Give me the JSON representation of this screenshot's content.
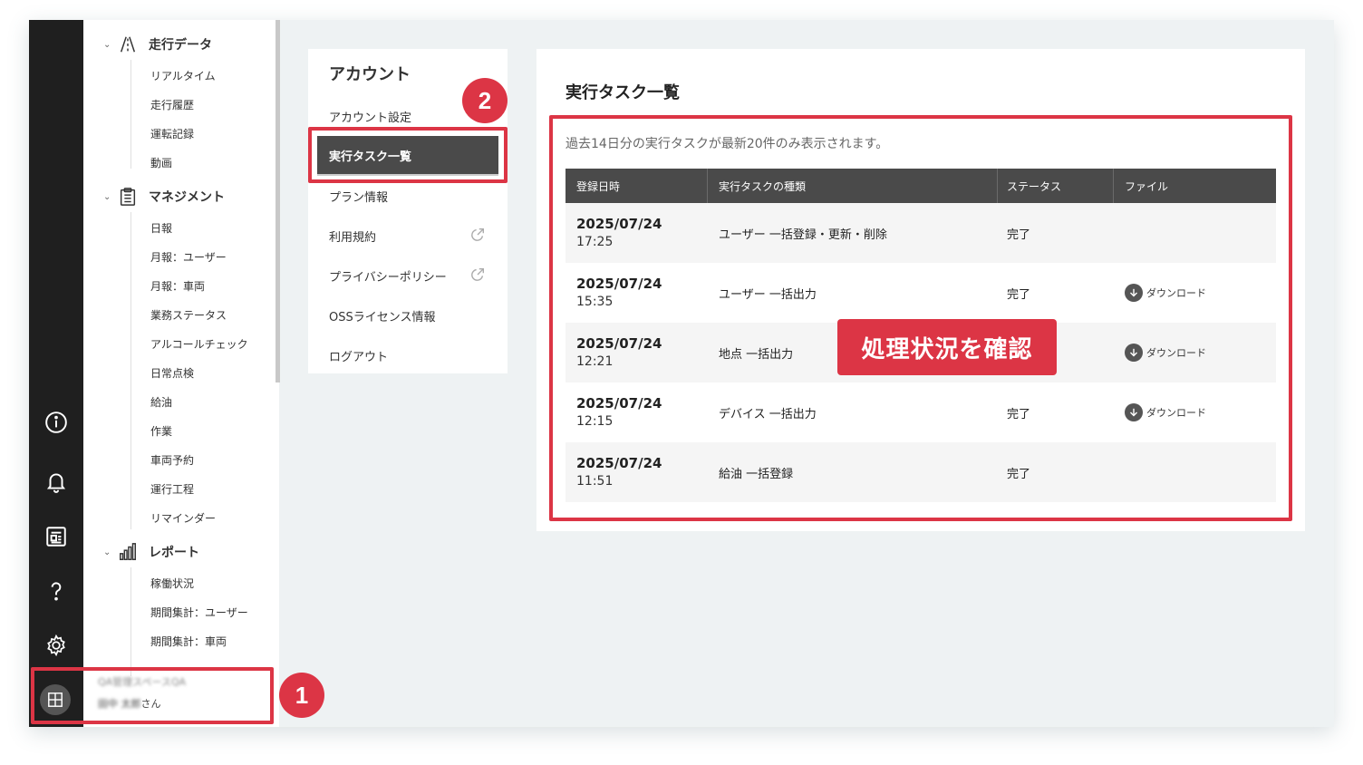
{
  "sidebar": {
    "sections": [
      {
        "label": "走行データ",
        "icon": "road-icon",
        "items": [
          "リアルタイム",
          "走行履歴",
          "運転記録",
          "動画"
        ]
      },
      {
        "label": "マネジメント",
        "icon": "clipboard-icon",
        "items": [
          "日報",
          "月報：ユーザー",
          "月報：車両",
          "業務ステータス",
          "アルコールチェック",
          "日常点検",
          "給油",
          "作業",
          "車両予約",
          "運行工程",
          "リマインダー"
        ]
      },
      {
        "label": "レポート",
        "icon": "bar-chart-icon",
        "items": [
          "稼働状況",
          "期間集計：ユーザー",
          "期間集計：車両"
        ]
      }
    ],
    "user": {
      "org": "QA管理スペースQA",
      "name_blur": "田中 太郎",
      "name_suffix": "さん"
    }
  },
  "rail": {
    "icons": [
      "info-icon",
      "bell-icon",
      "news-icon",
      "help-icon",
      "gear-icon"
    ],
    "avatar_icon": "grid-icon"
  },
  "account_menu": {
    "title": "アカウント",
    "items": [
      {
        "label": "アカウント設定",
        "external": false,
        "active": false
      },
      {
        "label": "実行タスク一覧",
        "external": false,
        "active": true
      },
      {
        "label": "プラン情報",
        "external": false,
        "active": false
      },
      {
        "label": "利用規約",
        "external": true,
        "active": false
      },
      {
        "label": "プライバシーポリシー",
        "external": true,
        "active": false
      },
      {
        "label": "OSSライセンス情報",
        "external": false,
        "active": false
      },
      {
        "label": "ログアウト",
        "external": false,
        "active": false
      }
    ]
  },
  "main": {
    "title": "実行タスク一覧",
    "notice": "過去14日分の実行タスクが最新20件のみ表示されます。",
    "columns": [
      "登録日時",
      "実行タスクの種類",
      "ステータス",
      "ファイル"
    ],
    "rows": [
      {
        "date": "2025/07/24",
        "time": "17:25",
        "type": "ユーザー 一括登録・更新・削除",
        "status": "完了",
        "file": ""
      },
      {
        "date": "2025/07/24",
        "time": "15:35",
        "type": "ユーザー 一括出力",
        "status": "完了",
        "file": "ダウンロード"
      },
      {
        "date": "2025/07/24",
        "time": "12:21",
        "type": "地点 一括出力",
        "status": "",
        "file": "ダウンロード"
      },
      {
        "date": "2025/07/24",
        "time": "12:15",
        "type": "デバイス 一括出力",
        "status": "完了",
        "file": "ダウンロード"
      },
      {
        "date": "2025/07/24",
        "time": "11:51",
        "type": "給油 一括登録",
        "status": "完了",
        "file": ""
      }
    ]
  },
  "annotations": {
    "step1": "1",
    "step2": "2",
    "callout": "処理状況を確認",
    "color": "#dc3545"
  }
}
